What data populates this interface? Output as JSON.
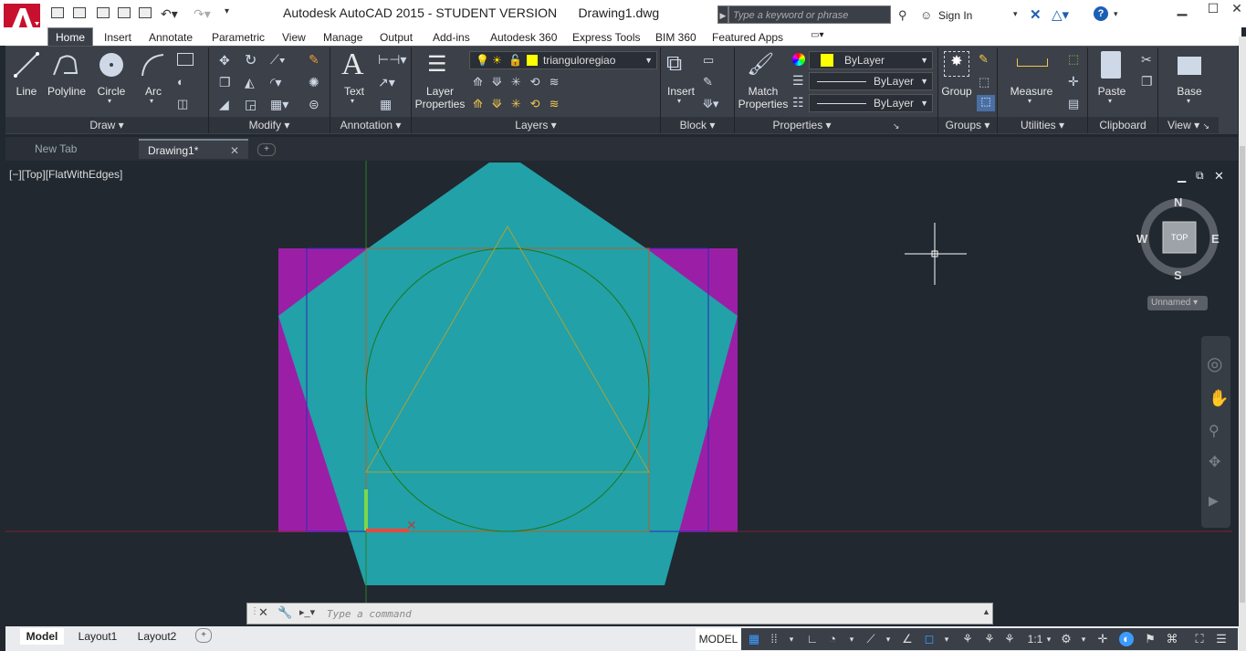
{
  "title": {
    "app_title": "Autodesk AutoCAD 2015 - STUDENT VERSION",
    "file_name": "Drawing1.dwg",
    "search_placeholder": "Type a keyword or phrase",
    "sign_in": "Sign In"
  },
  "ribbon_tabs": [
    "Home",
    "Insert",
    "Annotate",
    "Parametric",
    "View",
    "Manage",
    "Output",
    "Add-ins",
    "Autodesk 360",
    "Express Tools",
    "BIM 360",
    "Featured Apps"
  ],
  "draw": {
    "line": "Line",
    "polyline": "Polyline",
    "circle": "Circle",
    "arc": "Arc",
    "panel": "Draw"
  },
  "modify": {
    "panel": "Modify"
  },
  "annotation": {
    "text": "Text",
    "panel": "Annotation"
  },
  "layers": {
    "layer_properties_1": "Layer",
    "layer_properties_2": "Properties",
    "current_layer": "trianguloregiao",
    "panel": "Layers"
  },
  "block": {
    "insert": "Insert",
    "panel": "Block"
  },
  "properties": {
    "match_1": "Match",
    "match_2": "Properties",
    "color": "ByLayer",
    "linetype": "ByLayer",
    "lineweight": "ByLayer",
    "panel": "Properties"
  },
  "groups": {
    "group": "Group",
    "panel": "Groups"
  },
  "utilities": {
    "measure": "Measure",
    "panel": "Utilities"
  },
  "clipboard": {
    "paste": "Paste",
    "panel": "Clipboard"
  },
  "view": {
    "base": "Base",
    "panel": "View"
  },
  "file_tabs": {
    "new_tab": "New Tab",
    "drawing": "Drawing1*"
  },
  "viewport": {
    "label": "[−][Top][FlatWithEdges]"
  },
  "viewcube": {
    "n": "N",
    "s": "S",
    "e": "E",
    "w": "W",
    "top": "TOP",
    "ucs": "Unnamed"
  },
  "command": {
    "placeholder": "Type a command"
  },
  "layout_tabs": [
    "Model",
    "Layout1",
    "Layout2"
  ],
  "status": {
    "model": "MODEL",
    "scale": "1:1"
  },
  "colors": {
    "accent": "#c8102e",
    "cyan_fill": "#22a1a8",
    "magenta_fill": "#9b1fa6",
    "canvas": "#212830",
    "ribbon": "#3b4049"
  }
}
